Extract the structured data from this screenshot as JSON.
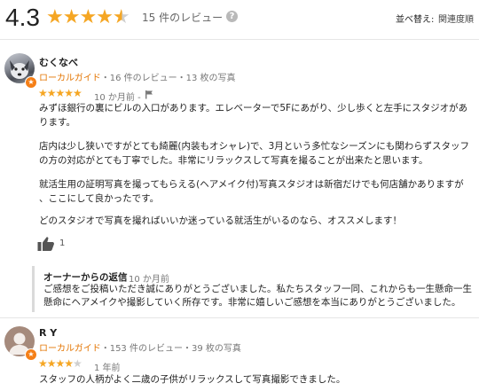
{
  "summary": {
    "rating": "4.3",
    "review_count": "15 件のレビュー",
    "sort_label": "並べ替え:",
    "sort_value": "関連度順",
    "stars_full": "★★★★",
    "stars_half": "★"
  },
  "reviews": [
    {
      "name": "むくなべ",
      "badge": "ローカルガイド",
      "stats": "・16 件のレビュー・13 枚の写真",
      "stars_filled": "★★★★★",
      "stars_empty": "",
      "time": "10 か月前",
      "time_sep": "-",
      "paragraphs": [
        "みずほ銀行の裏にビルの入口があります。エレベーターで5Fにあがり、少し歩くと左手にスタジオがあ",
        "ります。",
        "店内は少し狭いですがとても綺麗(内装もオシャレ)で、3月という多忙なシーズンにも関わらずスタッフ",
        "の方の対応がとても丁寧でした。非常にリラックスして写真を撮ることが出来たと思います。",
        "就活生用の証明写真を撮ってもらえる(ヘアメイク付)写真スタジオは新宿だけでも何店舗かありますが",
        "、ここにして良かったです。",
        "どのスタジオで写真を撮ればいいか迷っている就活生がいるのなら、オススメします！"
      ],
      "likes": "1",
      "owner_reply": {
        "title": "オーナーからの返信",
        "time": "10 か月前",
        "lines": [
          "ご感想をご投稿いただき誠にありがとうございました。私たちスタッフ一同、これからも一生懸命一生",
          "懸命にヘアメイクや撮影していく所存です。非常に嬉しいご感想を本当にありがとうございました。"
        ]
      }
    },
    {
      "name": "R Y",
      "badge": "ローカルガイド",
      "stats": "・153 件のレビュー・39 枚の写真",
      "stars_filled": "★★★★",
      "stars_empty": "★",
      "time": "1 年前",
      "paragraphs": [
        "スタッフの人柄がよく二歳の子供がリラックスして写真撮影できました。"
      ]
    }
  ],
  "colors": {
    "star": "#f5a623",
    "star_empty": "#cfcfcf",
    "guide": "#e37400",
    "badge": "#f57f17"
  },
  "icons": [
    "help-icon",
    "flag-icon",
    "like-icon",
    "local-guide-badge-icon"
  ]
}
